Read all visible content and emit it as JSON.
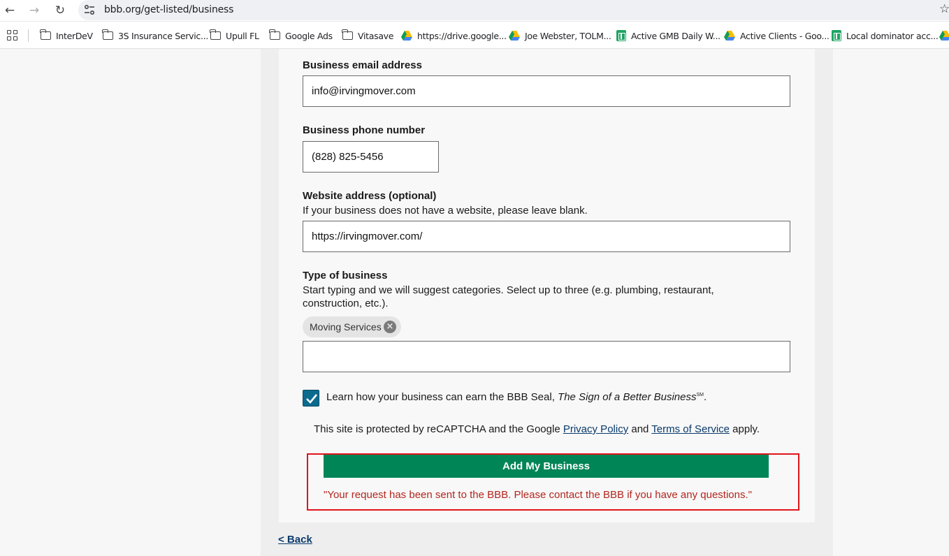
{
  "browser": {
    "url": "bbb.org/get-listed/business",
    "bookmarks": [
      {
        "icon": "folder-icon",
        "label": "InterDeV"
      },
      {
        "icon": "folder-icon",
        "label": "3S Insurance Servic..."
      },
      {
        "icon": "folder-icon",
        "label": "Upull FL"
      },
      {
        "icon": "folder-icon",
        "label": "Google Ads"
      },
      {
        "icon": "folder-icon",
        "label": "Vitasave"
      },
      {
        "icon": "drive-icon",
        "label": "https://drive.google..."
      },
      {
        "icon": "drive-icon",
        "label": "Joe Webster, TOLM..."
      },
      {
        "icon": "sheets-icon",
        "label": "Active GMB Daily W..."
      },
      {
        "icon": "drive-icon",
        "label": "Active Clients - Goo..."
      },
      {
        "icon": "sheets-icon",
        "label": "Local dominator acc..."
      }
    ]
  },
  "form": {
    "email": {
      "label": "Business email address",
      "value": "info@irvingmover.com"
    },
    "phone": {
      "label": "Business phone number",
      "value": "(828) 825-5456"
    },
    "website": {
      "label": "Website address (optional)",
      "hint": "If your business does not have a website, please leave blank.",
      "value": "https://irvingmover.com/"
    },
    "business_type": {
      "label": "Type of business",
      "hint_line1": "Start typing and we will suggest categories. Select up to three (e.g. plumbing, restaurant,",
      "hint_line2": "construction, etc.).",
      "selected_categories": [
        "Moving Services"
      ],
      "input_value": ""
    },
    "seal_checkbox": {
      "checked": true,
      "label_prefix": "Learn how your business can earn the BBB Seal, ",
      "label_italic": "The Sign of a Better Business",
      "label_mark": "SM",
      "label_suffix": "."
    },
    "recaptcha": {
      "prefix": "This site is protected by reCAPTCHA and the Google ",
      "privacy_link": "Privacy Policy",
      "and": " and ",
      "terms_link": "Terms of Service",
      "suffix": " apply."
    },
    "submit_label": "Add My Business",
    "success_message": "\"Your request has been sent to the BBB. Please contact the BBB if you have any questions.\"",
    "back_link": "< Back"
  },
  "colors": {
    "submit_button": "#008556",
    "highlight_border": "#e0141c",
    "message_text": "#b3261e",
    "checkbox_fill": "#0b6b8f",
    "link": "#0a3a6b"
  }
}
